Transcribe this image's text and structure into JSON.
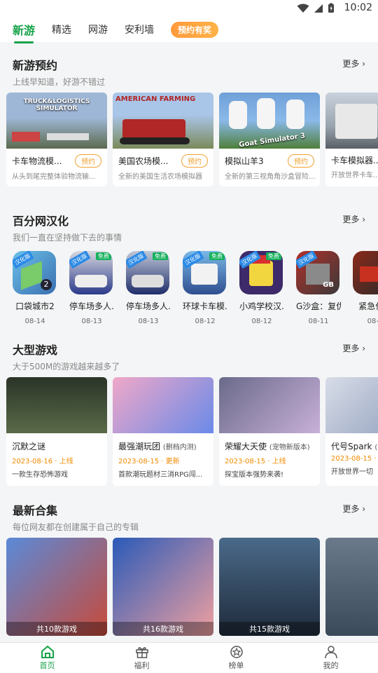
{
  "status": {
    "time": "10:02"
  },
  "tabs": [
    {
      "label": "新游",
      "active": true
    },
    {
      "label": "精选"
    },
    {
      "label": "网游"
    },
    {
      "label": "安利墙"
    },
    {
      "label": "预约有奖",
      "promo": true
    }
  ],
  "sections": {
    "preorder": {
      "title": "新游预约",
      "subtitle": "上线早知道，好游不错过",
      "more": "更多",
      "items": [
        {
          "name": "卡车物流模...",
          "button": "预约",
          "desc": "从头到尾完整体验物流输...",
          "thumb_text": "TRUCK&LOGISTICS SIMULATOR",
          "colors": [
            "#9fb7d6",
            "#5b6a4e"
          ]
        },
        {
          "name": "美国农场模...",
          "button": "预约",
          "desc": "全新的美国生活农场模拟器",
          "thumb_text": "AMERICAN FARMING",
          "colors": [
            "#a9c5e8",
            "#b12626"
          ]
        },
        {
          "name": "模拟山羊3",
          "button": "预约",
          "desc": "全新的第三视角角沙盒冒险...",
          "thumb_text": "Goat Simulator 3",
          "colors": [
            "#6fa0d8",
            "#4f7f3a"
          ]
        },
        {
          "name": "卡车模拟器...",
          "button": "预约",
          "desc": "开放世界卡车...",
          "thumb_text": "",
          "colors": [
            "#c9d2dc",
            "#5a5f66"
          ]
        }
      ]
    },
    "localized": {
      "title": "百分网汉化",
      "subtitle": "我们一直在坚持做下去的事情",
      "more": "更多",
      "tag": "汉化版",
      "free": "免费",
      "items": [
        {
          "name": "口袋城市2",
          "date": "08-14",
          "colors": [
            "#6bc0e8",
            "#3a6fb0"
          ]
        },
        {
          "name": "停车场多人...",
          "date": "08-13",
          "colors": [
            "#d8d8e0",
            "#2b3a8a"
          ]
        },
        {
          "name": "停车场多人...",
          "date": "08-13",
          "colors": [
            "#c0c8d8",
            "#1f2d6a"
          ]
        },
        {
          "name": "环球卡车模...",
          "date": "08-12",
          "colors": [
            "#7ab8e8",
            "#2f4f8f"
          ]
        },
        {
          "name": "小鸡学校汉...",
          "date": "08-12",
          "colors": [
            "#3c2a6a",
            "#f2d640"
          ]
        },
        {
          "name": "G沙盒：复仇",
          "date": "08-11",
          "colors": [
            "#b0302a",
            "#3a3a3a"
          ]
        },
        {
          "name": "紧急任...",
          "date": "08-0",
          "colors": [
            "#8a2a1a",
            "#2a2a2a"
          ]
        }
      ]
    },
    "big_games": {
      "title": "大型游戏",
      "subtitle": "大于500M的游戏越来越多了",
      "more": "更多",
      "items": [
        {
          "name": "沉默之谜",
          "note": "",
          "meta": "2023-08-16 · 上线",
          "desc": "一款生存恐怖游戏",
          "colors": [
            "#2a3428",
            "#5a6a48"
          ]
        },
        {
          "name": "最强潮玩团",
          "note": "(删档内测)",
          "meta": "2023-08-15 · 更新",
          "desc": "首款潮玩题材三消RPG闯...",
          "colors": [
            "#f0a8c8",
            "#6a8ae8"
          ]
        },
        {
          "name": "荣耀大天使",
          "note": "(宠物新版本)",
          "meta": "2023-08-15 · 上线",
          "desc": "探宝版本强势来袭!",
          "colors": [
            "#6a6a8a",
            "#c8b0d8"
          ]
        },
        {
          "name": "代号Spark",
          "note": "(",
          "meta": "2023-08-15 · ...",
          "desc": "开放世界一切",
          "colors": [
            "#d8dde8",
            "#8a9ab8"
          ]
        }
      ]
    },
    "collections": {
      "title": "最新合集",
      "subtitle": "每位网友都在创建属于自己的专辑",
      "more": "更多",
      "items": [
        {
          "count": "共10款游戏",
          "colors": [
            "#5a8ad8",
            "#c84a3a"
          ]
        },
        {
          "count": "共16款游戏",
          "colors": [
            "#2a5ab8",
            "#f0a0a0"
          ]
        },
        {
          "count": "共15款游戏",
          "colors": [
            "#4a6a8a",
            "#1f2a3a"
          ]
        },
        {
          "count": "",
          "colors": [
            "#6a7a8a",
            "#3a4a5a"
          ]
        }
      ]
    }
  },
  "bottom_nav": [
    {
      "label": "首页",
      "icon": "home-icon",
      "active": true
    },
    {
      "label": "福利",
      "icon": "gift-icon"
    },
    {
      "label": "榜单",
      "icon": "trophy-icon"
    },
    {
      "label": "我的",
      "icon": "profile-icon"
    }
  ],
  "colors": {
    "accent": "#17a34a",
    "orange": "#f0a030"
  }
}
